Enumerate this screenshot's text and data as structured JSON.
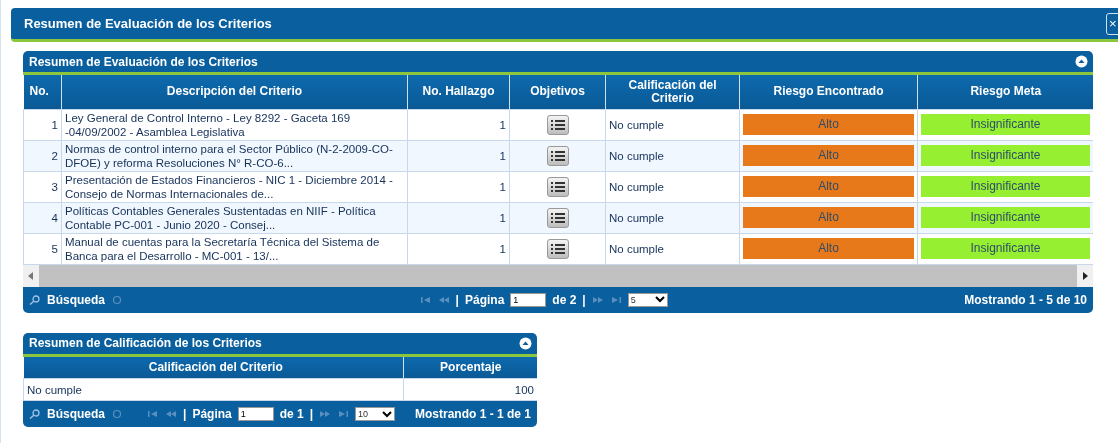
{
  "window": {
    "title": "Resumen de Evaluación de los Criterios",
    "close": "×"
  },
  "main_grid": {
    "title": "Resumen de Evaluación de los Criterios",
    "columns": [
      "No.",
      "Descripción del Criterio",
      "No. Hallazgo",
      "Objetivos",
      "Calificación del Criterio",
      "Riesgo Encontrado",
      "Riesgo Meta"
    ],
    "rows": [
      {
        "no": "1",
        "description": "Ley General de Control Interno - Ley 8292 - Gaceta 169 -04/09/2002 - Asamblea Legislativa",
        "hallazgo": "1",
        "calificacion": "No cumple",
        "riesgo_encontrado": {
          "label": "Alto",
          "color": "#e8791a"
        },
        "riesgo_meta": {
          "label": "Insignificante",
          "color": "#96f031"
        }
      },
      {
        "no": "2",
        "description": "Normas de control interno para el Sector Público (N-2-2009-CO-DFOE) y reforma Resoluciones N° R-CO-6...",
        "hallazgo": "1",
        "calificacion": "No cumple",
        "riesgo_encontrado": {
          "label": "Alto",
          "color": "#e8791a"
        },
        "riesgo_meta": {
          "label": "Insignificante",
          "color": "#96f031"
        }
      },
      {
        "no": "3",
        "description": "Presentación de Estados Financieros - NIC 1 - Diciembre 2014 - Consejo de Normas Internacionales de...",
        "hallazgo": "1",
        "calificacion": "No cumple",
        "riesgo_encontrado": {
          "label": "Alto",
          "color": "#e8791a"
        },
        "riesgo_meta": {
          "label": "Insignificante",
          "color": "#96f031"
        }
      },
      {
        "no": "4",
        "description": "Políticas Contables Generales Sustentadas en NIIF - Política Contable PC-001 - Junio 2020 - Consej...",
        "hallazgo": "1",
        "calificacion": "No cumple",
        "riesgo_encontrado": {
          "label": "Alto",
          "color": "#e8791a"
        },
        "riesgo_meta": {
          "label": "Insignificante",
          "color": "#96f031"
        }
      },
      {
        "no": "5",
        "description": "Manual de cuentas para la Secretaría Técnica del Sistema de Banca para el Desarrollo - MC-001 - 13/...",
        "hallazgo": "1",
        "calificacion": "No cumple",
        "riesgo_encontrado": {
          "label": "Alto",
          "color": "#e8791a"
        },
        "riesgo_meta": {
          "label": "Insignificante",
          "color": "#96f031"
        }
      }
    ],
    "pager": {
      "search": "Búsqueda",
      "separator_left": "|",
      "page_label": "Página",
      "page": "1",
      "of": "de 2",
      "separator_right": "|",
      "page_size": "5",
      "showing": "Mostrando 1 - 5 de 10"
    }
  },
  "summary_grid": {
    "title": "Resumen de Calificación de los Criterios",
    "columns": [
      "Calificación del Criterio",
      "Porcentaje"
    ],
    "rows": [
      {
        "calificacion": "No cumple",
        "porcentaje": "100"
      }
    ],
    "pager": {
      "search": "Búsqueda",
      "separator_left": "|",
      "page_label": "Página",
      "page": "1",
      "of": "de 1",
      "separator_right": "|",
      "page_size": "10",
      "showing": "Mostrando 1 - 1 de 1"
    }
  }
}
